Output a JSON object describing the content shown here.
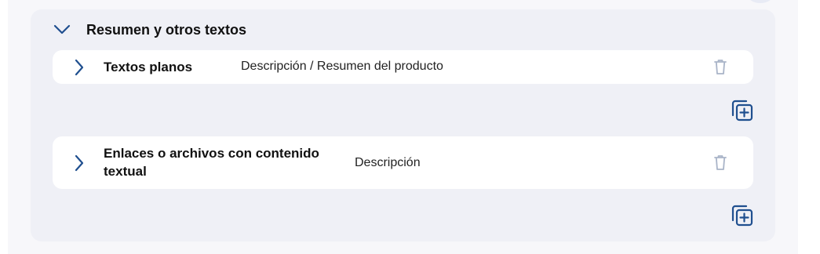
{
  "section": {
    "title": "Resumen y otros textos",
    "expanded": true,
    "icon": "chevron-down-icon"
  },
  "items": [
    {
      "title": "Textos planos",
      "description": "Descripción / Resumen del producto",
      "icon": "chevron-right-icon",
      "delete_icon": "trash-icon",
      "add_icon": "copy-add-icon"
    },
    {
      "title": "Enlaces o archivos con contenido textual",
      "description": "Descripción",
      "icon": "chevron-right-icon",
      "delete_icon": "trash-icon",
      "add_icon": "copy-add-icon"
    }
  ],
  "colors": {
    "accent": "#1f4f8f",
    "trash": "#a9b4c8",
    "card_bg": "#eff0f6",
    "row_bg": "#ffffff"
  }
}
